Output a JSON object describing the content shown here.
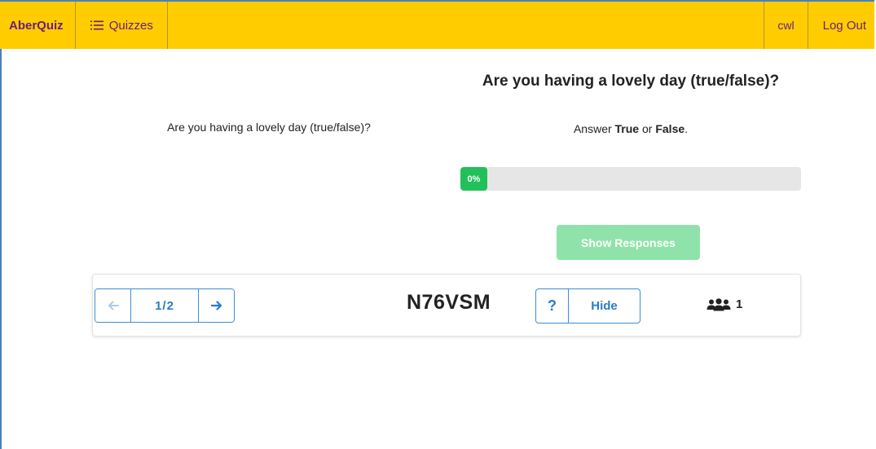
{
  "navbar": {
    "brand": "AberQuiz",
    "quizzes_label": "Quizzes",
    "user": "cwl",
    "logout": "Log Out",
    "bg_color": "#ffcc00",
    "text_color": "#6b1e7a"
  },
  "question": {
    "left_text": "Are you having a lovely day (true/false)?",
    "title": "Are you having a lovely day (true/false)?",
    "instruction_prefix": "Answer ",
    "instruction_true": "True",
    "instruction_or": " or ",
    "instruction_false": "False",
    "instruction_suffix": "."
  },
  "progress": {
    "label": "0%",
    "value": 0,
    "color": "#21c05a"
  },
  "show_responses": {
    "label": "Show Responses",
    "color": "#8fe3aa"
  },
  "control_bar": {
    "pager_label": "1/2",
    "prev_icon": "arrow-left-icon",
    "next_icon": "arrow-right-icon",
    "session_code": "N76VSM",
    "help_label": "?",
    "hide_label": "Hide",
    "participants_icon": "users-icon",
    "participants_count": "1",
    "accent_color": "#2a7cc4"
  }
}
